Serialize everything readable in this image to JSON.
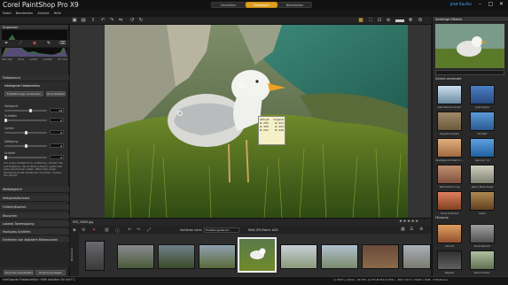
{
  "app": {
    "title": "Corel PaintShop Pro X9",
    "sign_in": "Jetzt Kaufen"
  },
  "workspace_tabs": [
    "Verwalten",
    "Anpassen",
    "Bearbeiten"
  ],
  "menu": [
    "Datei",
    "Bearbeiten",
    "Ansicht",
    "Hilfe"
  ],
  "left_panel": {
    "histogram_title": "Anpassen",
    "info_row": [
      "ISO 100",
      "f/5.6",
      "1/320",
      "1/1600",
      "67 mm"
    ],
    "sections": {
      "farbbalance": "Farbbalance",
      "intelligent": "Intelligente Fotokorrektur",
      "weissabgleich": "Weißabgleich",
      "helligkeit": "Helligkeit/Kontrast",
      "fuelllicht": "Fülllicht/Klarheit",
      "rauschen": "Rauschen",
      "lokale": "Lokales Tonemapping",
      "hochpass": "Hochpass Schärfen",
      "rote_augen": "Entfernen von digitalem Bildrauschen"
    },
    "buttons": {
      "empfehlung": "Empfehlungen anwenden",
      "zuruecksetzen": "Zurücksetzen"
    },
    "sliders": [
      {
        "label": "Helligkeit",
        "value": "19",
        "level": 0.62
      },
      {
        "label": "Schatten",
        "value": "0",
        "level": 0.0
      },
      {
        "label": "Lichter",
        "value": "0",
        "level": 0.5
      },
      {
        "label": "Sättigung",
        "value": "0",
        "level": 0.5
      },
      {
        "label": "Schärfe",
        "value": "0",
        "level": 0.0
      }
    ],
    "help_text": "Um einen Farbstich zu entfernen, klicken Sie auf Ergebnis, die im Bild schwarz, weiß oder grau erscheinen sollen. Wenn Sie einen Sampling-Punkt entfernen möchten, klicken Sie darauf.",
    "bottom_buttons": {
      "vorschau": "Vorschau bearbeiten",
      "original": "Original anzeigen"
    }
  },
  "tooltip": {
    "col1": "Aktuell",
    "col2": "Original",
    "rows": [
      [
        "R: 255",
        "R: 251"
      ],
      [
        "G: 255",
        "G: 253"
      ],
      [
        "B: 252",
        "B: 246"
      ]
    ]
  },
  "filmstrip": {
    "filename": "IMG_5889.jpg",
    "sort_label": "Sortieren nach:",
    "sort_value": "Erstellungsdatum - Absolut",
    "filter_label": "RAW-JPG-Paare: AUS",
    "stars": "★★★★★",
    "side_label": "Bibliothek"
  },
  "right_panel": {
    "title": "Sofortige Effekte",
    "applied_label": "Zuletzt verwendet",
    "category_label": "Filmische",
    "effects": [
      {
        "name": "Alte Kamera Linien"
      },
      {
        "name": "Cyanotypie"
      },
      {
        "name": "Daguerreotypie"
      },
      {
        "name": "Kontakt"
      },
      {
        "name": "Nostalgie Kontakt m..."
      },
      {
        "name": "Glamour (1)"
      },
      {
        "name": "Weichzeichnung"
      },
      {
        "name": "Japan Teale Sepia"
      },
      {
        "name": "Hohe Kontrast"
      },
      {
        "name": "Sepia"
      },
      {
        "name": "Infrarot"
      },
      {
        "name": "Kontrastreich"
      },
      {
        "name": "Negativ"
      },
      {
        "name": "Retro Farben"
      }
    ]
  },
  "status": {
    "left": "Intelligente Fotokorrektur: Hilfe erhalten Sie mit F1.",
    "right": "(x:3875 y:1622) - (R:255, G:255,B:252,O:255) -- Bild: 5472 x 3648 x RGB - 8 Bit/Kanal"
  },
  "colors": {
    "accent": "#e0a020",
    "link": "#4aa8ff"
  },
  "icons": [
    "save-icon",
    "undo-icon",
    "redo-icon",
    "crop-icon",
    "fullscreen-icon",
    "zoom-icon"
  ]
}
